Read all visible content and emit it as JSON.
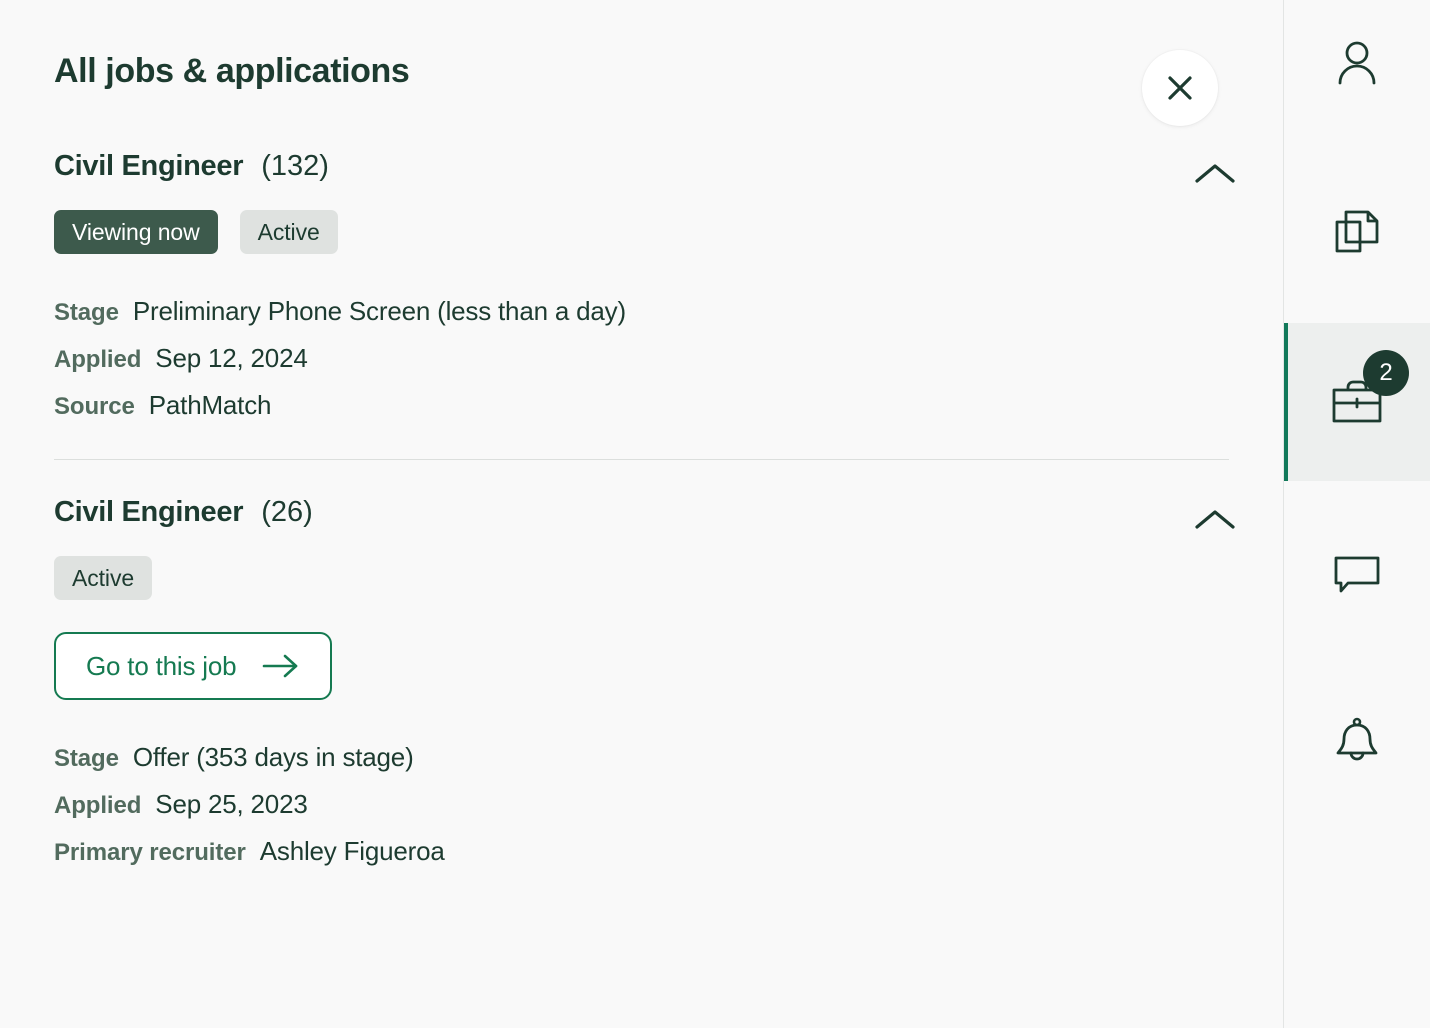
{
  "panel": {
    "title": "All jobs & applications",
    "close_icon": "close-icon"
  },
  "jobs": [
    {
      "title": "Civil Engineer",
      "count": "(132)",
      "collapse_icon": "chevron-up-icon",
      "badges": [
        {
          "label": "Viewing now",
          "style": "dark"
        },
        {
          "label": "Active",
          "style": "grey"
        }
      ],
      "details": [
        {
          "label": "Stage",
          "value": "Preliminary Phone Screen (less than a day)"
        },
        {
          "label": "Applied",
          "value": "Sep 12, 2024"
        },
        {
          "label": "Source",
          "value": "PathMatch"
        }
      ]
    },
    {
      "title": "Civil Engineer",
      "count": "(26)",
      "collapse_icon": "chevron-up-icon",
      "badges": [
        {
          "label": "Active",
          "style": "grey"
        }
      ],
      "action": {
        "label": "Go to this job",
        "icon": "arrow-right-icon"
      },
      "details": [
        {
          "label": "Stage",
          "value": "Offer (353 days in stage)"
        },
        {
          "label": "Applied",
          "value": "Sep 25, 2023"
        },
        {
          "label": "Primary recruiter",
          "value": "Ashley Figueroa"
        }
      ]
    }
  ],
  "rail": {
    "items": [
      {
        "name": "profile",
        "icon": "person-icon",
        "active": false,
        "badge": null
      },
      {
        "name": "documents",
        "icon": "documents-icon",
        "active": false,
        "badge": null
      },
      {
        "name": "jobs",
        "icon": "briefcase-icon",
        "active": true,
        "badge": "2"
      },
      {
        "name": "messages",
        "icon": "chat-bubble-icon",
        "active": false,
        "badge": null
      },
      {
        "name": "notifications",
        "icon": "bell-icon",
        "active": false,
        "badge": null
      }
    ]
  },
  "colors": {
    "background": "#f9f9f9",
    "text_primary": "#1d3b30",
    "text_label": "#526b5e",
    "accent_green": "#157a51",
    "rail_active_bar": "#12795a",
    "badge_dark": "#3d5a4c",
    "badge_grey": "#dfe2e0"
  }
}
